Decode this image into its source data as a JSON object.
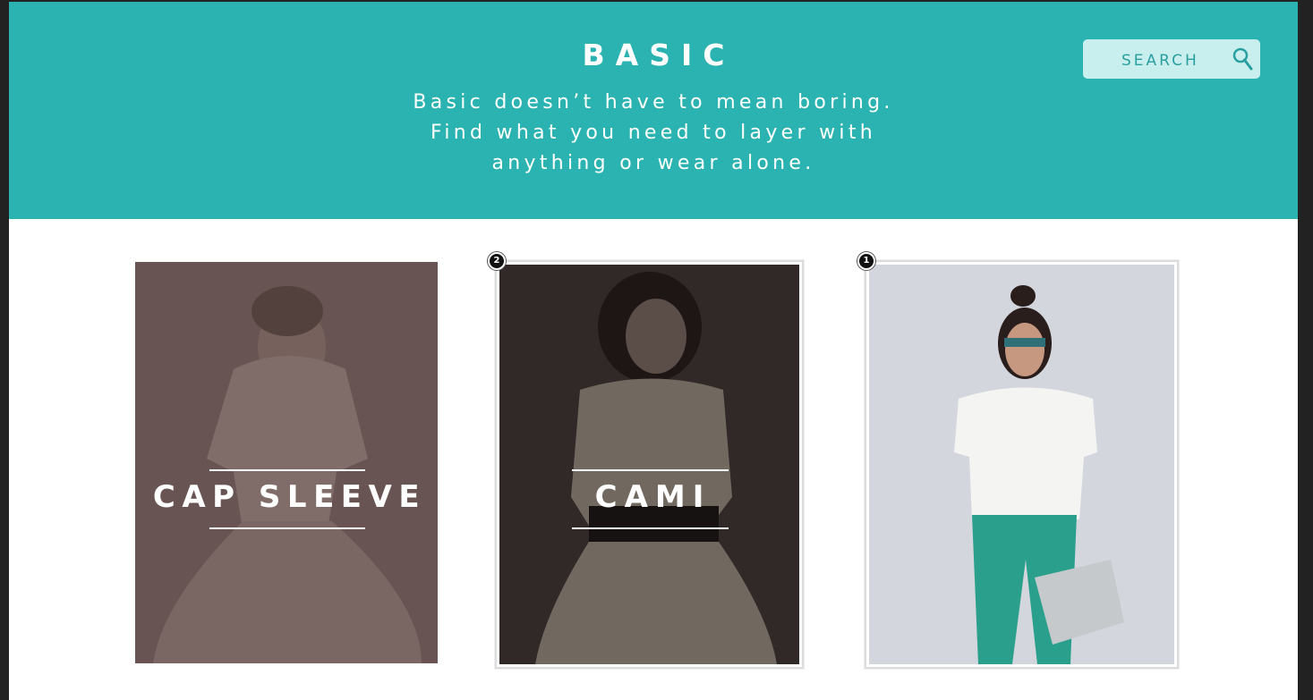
{
  "header": {
    "title": "BASIC",
    "tagline": [
      "Basic doesn’t have to mean boring.",
      "Find what you need to layer with",
      "anything or wear alone."
    ],
    "background_color": "#2bb3b1"
  },
  "search": {
    "label": "SEARCH",
    "icon": "search-icon"
  },
  "cards": [
    {
      "label": "CAP SLEEVE",
      "badge": ""
    },
    {
      "label": "CAMI",
      "badge": "2"
    },
    {
      "label": "",
      "badge": "1"
    }
  ]
}
